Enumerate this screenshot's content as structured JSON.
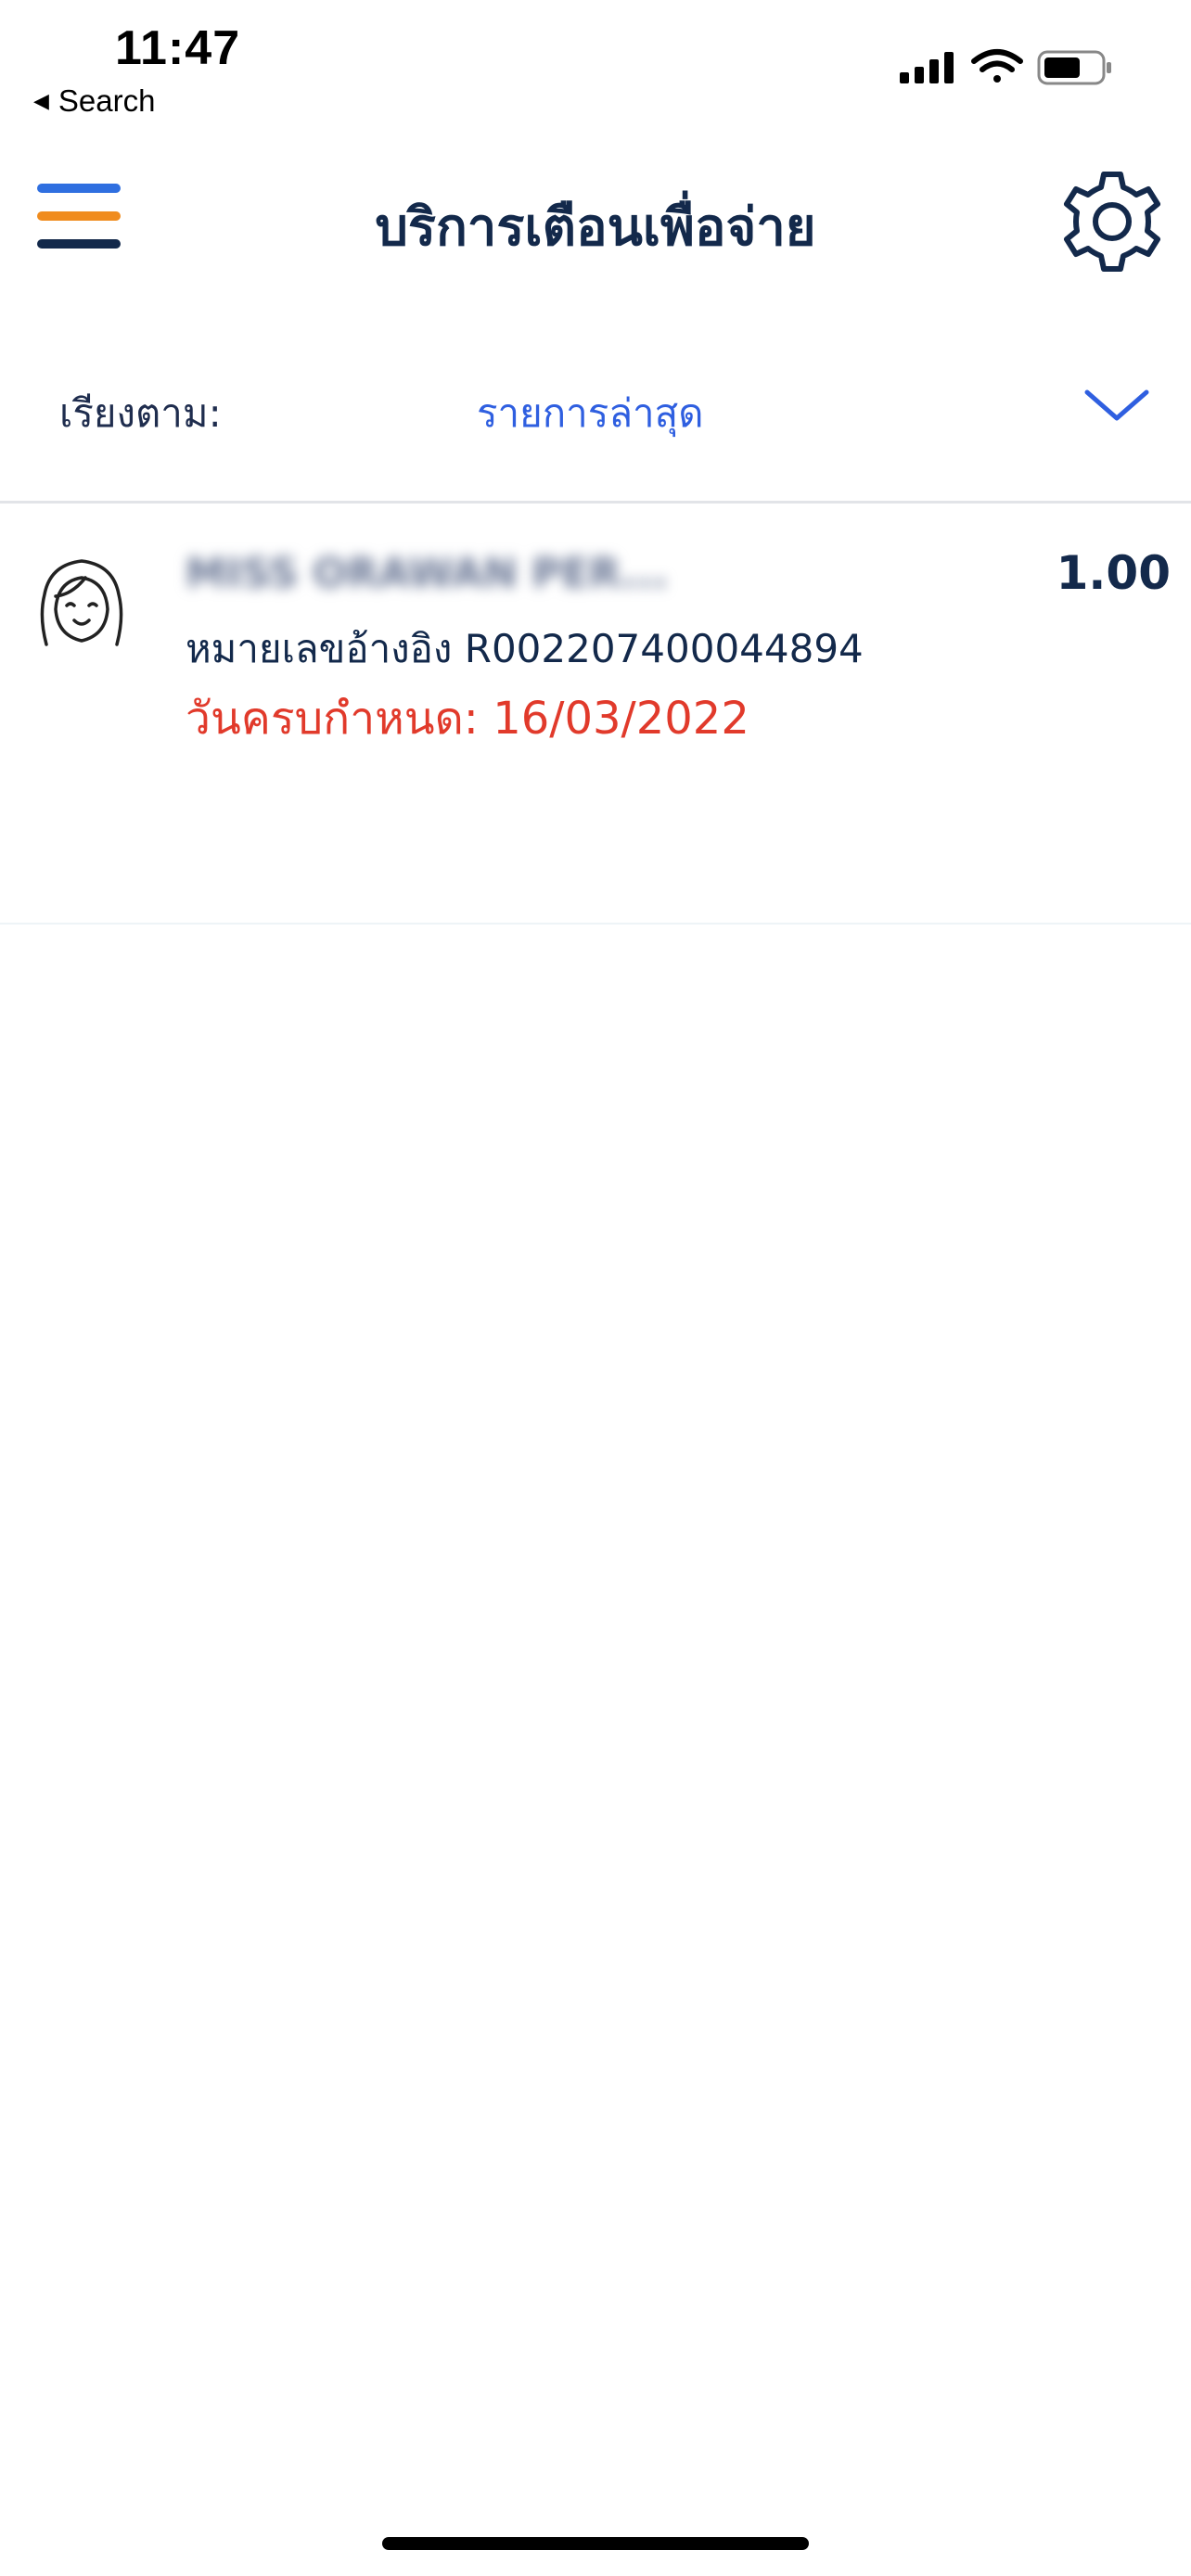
{
  "status_bar": {
    "time": "11:47",
    "back_label": "Search"
  },
  "header": {
    "title": "บริการเตือนเพื่อจ่าย"
  },
  "sort": {
    "label": "เรียงตาม:",
    "value": "รายการล่าสุด"
  },
  "items": [
    {
      "name": "MISS ORAWAN PER...",
      "amount": "1.00",
      "reference": "หมายเลขอ้างอิง R002207400044894",
      "due": "วันครบกำหนด: 16/03/2022"
    }
  ],
  "colors": {
    "primary_text": "#13294b",
    "accent_blue": "#2f5fe0",
    "due_red": "#e13a2b",
    "menu_orange": "#f08c1e",
    "menu_blue": "#2f6fe0",
    "menu_navy": "#13294b"
  },
  "icons": {
    "menu": "hamburger-menu-icon",
    "settings": "gear-icon",
    "sort_toggle": "chevron-down-icon",
    "avatar": "female-avatar-icon"
  }
}
